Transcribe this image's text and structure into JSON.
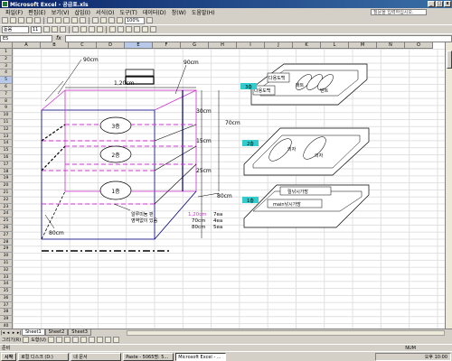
{
  "window": {
    "title": "Microsoft Excel - 공급표.xls"
  },
  "menu": [
    "파일(F)",
    "편집(E)",
    "보기(V)",
    "삽입(I)",
    "서식(O)",
    "도구(T)",
    "데이터(D)",
    "창(W)",
    "도움말(H)"
  ],
  "help_placeholder": "질문을 입력하십시오.",
  "toolbar": {
    "zoom": "100%",
    "font": "돋움",
    "size": "11"
  },
  "formula_bar": {
    "name_box": "E5",
    "fx": "fx",
    "value": ""
  },
  "columns": [
    "A",
    "B",
    "C",
    "D",
    "E",
    "F",
    "G",
    "H",
    "I",
    "J",
    "K",
    "L",
    "M",
    "N",
    "O"
  ],
  "rows": [
    "1",
    "2",
    "3",
    "4",
    "5",
    "6",
    "7",
    "8",
    "9",
    "10",
    "11",
    "12",
    "13",
    "14",
    "15",
    "16",
    "17",
    "18",
    "19",
    "20",
    "21",
    "22",
    "23",
    "24",
    "25",
    "26",
    "27",
    "28",
    "29",
    "30",
    "31",
    "32",
    "33",
    "34",
    "35",
    "36",
    "37",
    "38",
    "39",
    "40"
  ],
  "drawing": {
    "dim_top_left": "90cm",
    "dim_top_right": "90cm",
    "dim_width": "1,20cm",
    "dim_h30": "30cm",
    "dim_h15": "15cm",
    "dim_h25": "25cm",
    "dim_total": "70cm",
    "dim_bottom_right": "80cm",
    "dim_bottom_left": "80cm",
    "floor_3": "3층",
    "floor_2": "2층",
    "floor_1": "1층",
    "bottom_note_line1": "알루미늄 판",
    "bottom_note_line2": "영역없이 있음",
    "legend": [
      {
        "size": "1,20cm",
        "count": "7ea",
        "color": "#cc33cc"
      },
      {
        "size": "70cm",
        "count": "4ea",
        "color": "#000000"
      },
      {
        "size": "80cm",
        "count": "5ea",
        "color": "#000000"
      }
    ],
    "right_tag_3": "3층",
    "right_tag_2": "2층",
    "right_tag_1": "1층",
    "item_dadong_1": "다용도백",
    "item_dadong_2": "다용도백",
    "item_matt": "매트",
    "item_tent": "텐트",
    "item_chair_1": "의자",
    "item_chair_2": "의자",
    "item_bag_1": "릴낚시가방",
    "item_bag_2": "main낚시가방",
    "accent": "#33cccc"
  },
  "sheet_tabs": [
    "Sheet1",
    "Sheet2",
    "Sheet3"
  ],
  "draw_label": "그리기(R)",
  "autoshape_label": "도형(U)",
  "status": {
    "left": "준비",
    "num": "NUM"
  },
  "taskbar": {
    "start": "시작",
    "tasks": [
      "로컬 디스크 (D:)",
      "내 문서",
      "Paste - 5065명: 5...",
      "Microsoft Excel - ..."
    ],
    "clock": "오후 10:00"
  }
}
